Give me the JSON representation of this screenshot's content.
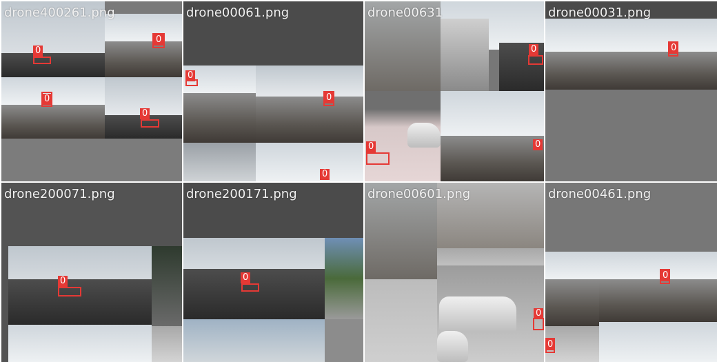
{
  "tiles": [
    {
      "title": "drone400261.png",
      "label": "0"
    },
    {
      "title": "drone00061.png",
      "label": "0"
    },
    {
      "title": "drone00631",
      "label": "0"
    },
    {
      "title": "drone00031.png",
      "label": "0"
    },
    {
      "title": "drone200071.png",
      "label": "0"
    },
    {
      "title": "drone200171.png",
      "label": "0"
    },
    {
      "title": "drone00601.png",
      "label": "0"
    },
    {
      "title": "drone00461.png",
      "label": "0"
    }
  ],
  "colors": {
    "box": "#e53935",
    "background": "#777777",
    "dark_panel": "#4b4b4b"
  }
}
